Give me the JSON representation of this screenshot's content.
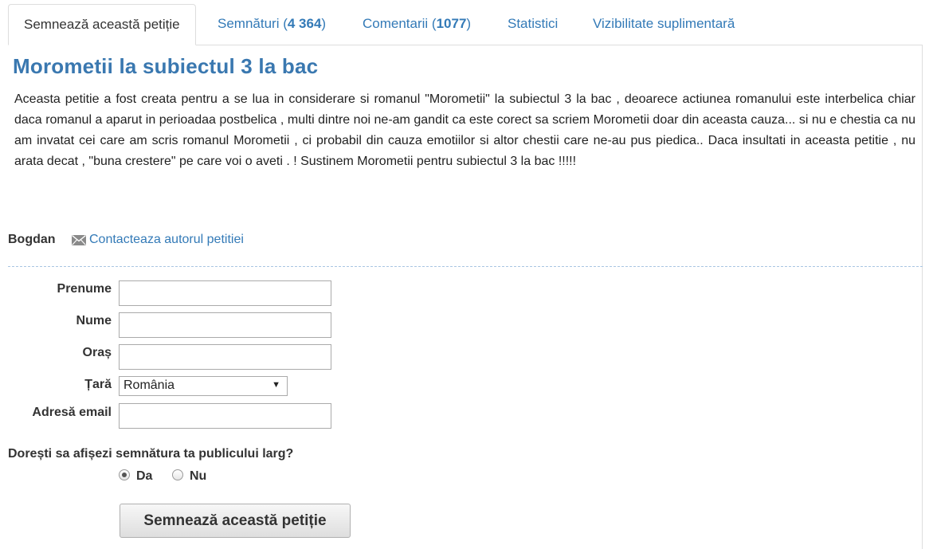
{
  "tabs": [
    {
      "label": "Semnează această petiție",
      "active": true
    },
    {
      "label": "Semnături",
      "count": "4 364"
    },
    {
      "label": "Comentarii",
      "count": "1077"
    },
    {
      "label": "Statistici"
    },
    {
      "label": "Vizibilitate suplimentară"
    }
  ],
  "petition": {
    "title": "Morometii la subiectul 3 la bac",
    "description": "Aceasta petitie a fost creata pentru a se lua in considerare si romanul \"Morometii\" la subiectul 3 la bac , deoarece actiunea romanului este interbelica chiar daca romanul a aparut in perioadaa postbelica , multi dintre noi ne-am gandit ca este corect sa scriem Morometii doar din aceasta cauza... si nu e chestia ca nu am invatat cei care am scris romanul Morometii , ci probabil din cauza emotiilor si altor chestii care ne-au pus piedica.. Daca insultati in aceasta petitie , nu arata decat , \"buna crestere\" pe care voi o aveti . ! Sustinem Morometii pentru subiectul 3 la bac !!!!!"
  },
  "author": {
    "name": "Bogdan",
    "contact_label": "Contacteaza autorul petitiei",
    "icon": "envelope-icon"
  },
  "form": {
    "first_name_label": "Prenume",
    "first_name_value": "",
    "last_name_label": "Nume",
    "last_name_value": "",
    "city_label": "Oraș",
    "city_value": "",
    "country_label": "Țară",
    "country_value": "România",
    "email_label": "Adresă email",
    "email_value": "",
    "visibility_question": "Dorești sa afișezi semnătura ta publicului larg?",
    "visibility_yes": "Da",
    "visibility_no": "Nu",
    "visibility_selected": "Da",
    "submit_label": "Semnează această petiție"
  },
  "colors": {
    "link": "#337ab7",
    "title": "#3a78b0",
    "text": "#333333",
    "border": "#dddddd"
  }
}
